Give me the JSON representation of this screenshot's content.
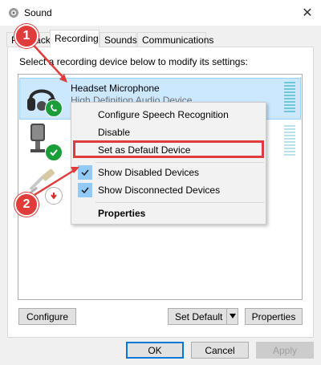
{
  "window": {
    "title": "Sound"
  },
  "tabs": [
    {
      "label": "Playback"
    },
    {
      "label": "Recording"
    },
    {
      "label": "Sounds"
    },
    {
      "label": "Communications"
    }
  ],
  "instruction": "Select a recording device below to modify its settings:",
  "devices": [
    {
      "name": "Headset Microphone",
      "subtitle": "High Definition Audio Device",
      "icon": "headset-icon",
      "status": "default-communication"
    },
    {
      "name": "",
      "subtitle": "",
      "icon": "microphone-icon",
      "status": "default"
    },
    {
      "name": "",
      "subtitle": "",
      "icon": "line-in-icon",
      "status": "disabled"
    }
  ],
  "context_menu": {
    "items": [
      {
        "label": "Configure Speech Recognition",
        "checked": false
      },
      {
        "label": "Disable",
        "checked": false
      },
      {
        "label": "Set as Default Device",
        "checked": false,
        "highlighted": true
      },
      {
        "label": "Show Disabled Devices",
        "checked": true
      },
      {
        "label": "Show Disconnected Devices",
        "checked": true
      },
      {
        "label": "Properties",
        "checked": false,
        "bold": true
      }
    ]
  },
  "buttons": {
    "configure": "Configure",
    "set_default": "Set Default",
    "properties": "Properties",
    "ok": "OK",
    "cancel": "Cancel",
    "apply": "Apply"
  },
  "annotations": [
    {
      "label": "1"
    },
    {
      "label": "2"
    }
  ],
  "colors": {
    "annotation": "#e03c3c",
    "selection": "#cce8ff",
    "check_bg": "#91c9f7",
    "status_green": "#1a9e3a"
  }
}
